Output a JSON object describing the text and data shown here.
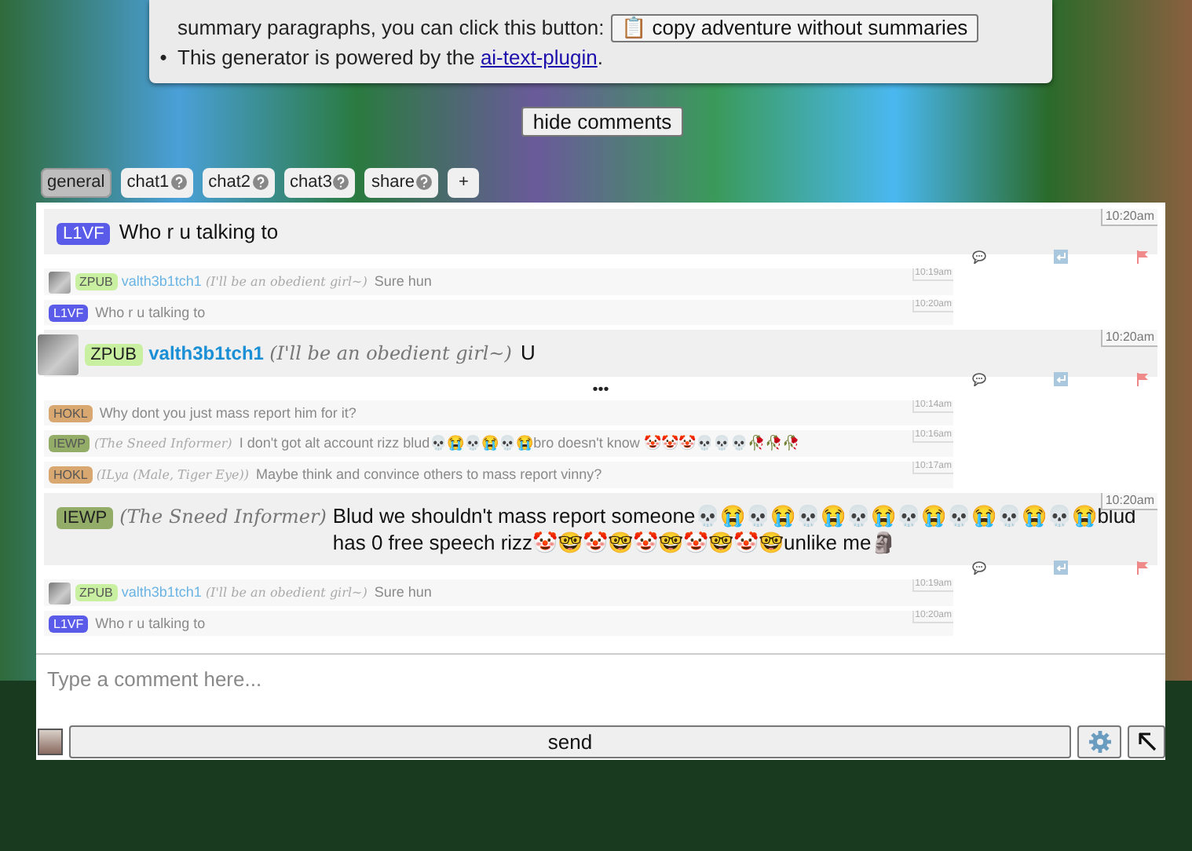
{
  "notice": {
    "items": [
      {
        "kind": "text",
        "marker": "",
        "text": "summary paragraphs, you can click this button:",
        "button": "📋 copy adventure without summaries"
      },
      {
        "kind": "link",
        "marker": "•",
        "text": "This generator is powered by the ",
        "link": "ai-text-plugin",
        "after": "."
      }
    ]
  },
  "hide_button": "hide comments",
  "tabs": [
    {
      "label": "general",
      "help": false,
      "selected": true
    },
    {
      "label": "chat1",
      "help": true,
      "selected": false
    },
    {
      "label": "chat2",
      "help": true,
      "selected": false
    },
    {
      "label": "chat3",
      "help": true,
      "selected": false
    },
    {
      "label": "share",
      "help": true,
      "selected": false
    },
    {
      "label": "+",
      "help": false,
      "selected": false
    }
  ],
  "messages": [
    {
      "kind": "full",
      "avatar": false,
      "badge": {
        "text": "L1VF",
        "color": "#5b5bea"
      },
      "text": "Who r u talking to",
      "time": "10:20am"
    },
    {
      "kind": "compact",
      "avatar": true,
      "badge": {
        "text": "ZPUB",
        "color": "#c8f0a0"
      },
      "name": "valth3b1tch1",
      "tagline": "(I'll be an obedient girl~)",
      "text": "Sure hun",
      "time": "10:19am"
    },
    {
      "kind": "compact",
      "avatar": false,
      "badge": {
        "text": "L1VF",
        "color": "#5b5bea"
      },
      "text": "Who r u talking to",
      "time": "10:20am"
    },
    {
      "kind": "full",
      "avatar": true,
      "badge": {
        "text": "ZPUB",
        "color": "#c8f0a0"
      },
      "name": "valth3b1tch1",
      "tagline": "(I'll be an obedient girl~)",
      "text": "U",
      "time": "10:20am",
      "more": "•••"
    },
    {
      "kind": "compact",
      "avatar": false,
      "badge": {
        "text": "HOKL",
        "color": "#d9a770"
      },
      "text": "Why dont you just mass report him for it?",
      "time": "10:14am"
    },
    {
      "kind": "compact",
      "avatar": false,
      "badge": {
        "text": "IEWP",
        "color": "#93ad68"
      },
      "tagline": "(The Sneed Informer)",
      "text": "I don't got alt account rizz blud💀😭💀😭💀😭bro doesn't know 🤡🤡🤡💀💀💀🥀🥀🥀",
      "time": "10:16am"
    },
    {
      "kind": "compact",
      "avatar": false,
      "badge": {
        "text": "HOKL",
        "color": "#d9a770"
      },
      "tagline": "(ILya (Male, Tiger Eye))",
      "text": "Maybe think and convince others to mass report vinny?",
      "time": "10:17am"
    },
    {
      "kind": "full",
      "avatar": false,
      "badge": {
        "text": "IEWP",
        "color": "#93ad68"
      },
      "tagline": "(The Sneed Informer)",
      "text": "Blud we shouldn't mass report someone💀😭💀😭💀😭💀😭💀😭💀😭💀😭💀😭blud has 0 free speech rizz🤡🤓🤡🤓🤡🤓🤡🤓🤡🤓unlike me🗿",
      "time": "10:20am"
    },
    {
      "kind": "compact",
      "avatar": true,
      "badge": {
        "text": "ZPUB",
        "color": "#c8f0a0"
      },
      "name": "valth3b1tch1",
      "tagline": "(I'll be an obedient girl~)",
      "text": "Sure hun",
      "time": "10:19am"
    },
    {
      "kind": "compact",
      "avatar": false,
      "badge": {
        "text": "L1VF",
        "color": "#5b5bea"
      },
      "text": "Who r u talking to",
      "time": "10:20am"
    }
  ],
  "composer": {
    "placeholder": "Type a comment here...",
    "send": "send"
  }
}
